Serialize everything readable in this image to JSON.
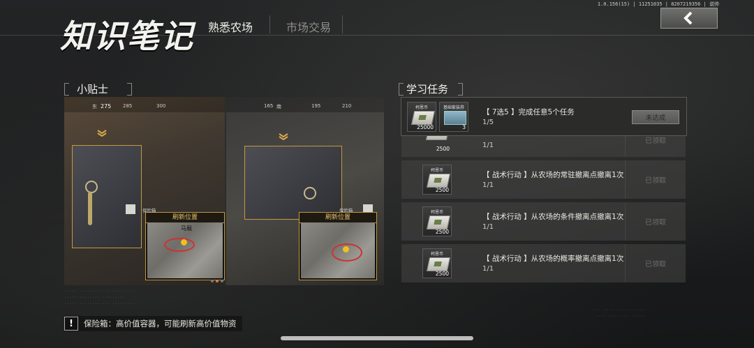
{
  "build_info": "1.0.156(15) | 11251035 | 8207219356 | 说帅",
  "header": {
    "logo": "知识笔记",
    "tabs": [
      {
        "label": "熟悉农场",
        "active": true
      },
      {
        "label": "市场交易",
        "active": false
      }
    ]
  },
  "tips": {
    "section_title": "小贴士",
    "compass_a": [
      "东",
      "275",
      "285",
      "300"
    ],
    "compass_b": [
      "165",
      "南",
      "195",
      "210"
    ],
    "inset_title": "刷新位置",
    "map_label_a": "马厩",
    "item_label": "保险箱",
    "description": "保险箱：高价值容器，可能刷新高价值物资",
    "carousel": {
      "pages": 3,
      "active_index": 1
    }
  },
  "tasks": {
    "section_title": "学习任务",
    "items": [
      {
        "title": "【 7选5 】完成任意5个任务",
        "progress": "1/5",
        "status": "未达成",
        "rewards": [
          {
            "label": "柯恩币",
            "amount": "25000"
          },
          {
            "label": "基础套装券",
            "amount": "3"
          }
        ]
      },
      {
        "title": "",
        "progress": "1/1",
        "status": "已领取",
        "rewards": [
          {
            "label": "柯恩币",
            "amount": "2500"
          }
        ]
      },
      {
        "title": "【 战术行动 】从农场的常驻撤离点撤离1次",
        "progress": "1/1",
        "status": "已领取",
        "rewards": [
          {
            "label": "柯恩币",
            "amount": "2500"
          }
        ]
      },
      {
        "title": "【 战术行动 】从农场的条件撤离点撤离1次",
        "progress": "1/1",
        "status": "已领取",
        "rewards": [
          {
            "label": "柯恩币",
            "amount": "2500"
          }
        ]
      },
      {
        "title": "【 战术行动 】从农场的概率撤离点撤离1次",
        "progress": "1/1",
        "status": "已领取",
        "rewards": [
          {
            "label": "柯恩币",
            "amount": "2500"
          }
        ]
      }
    ]
  },
  "colors": {
    "accent_gold": "#c49a3c",
    "active_dot": "#e07a3c"
  }
}
